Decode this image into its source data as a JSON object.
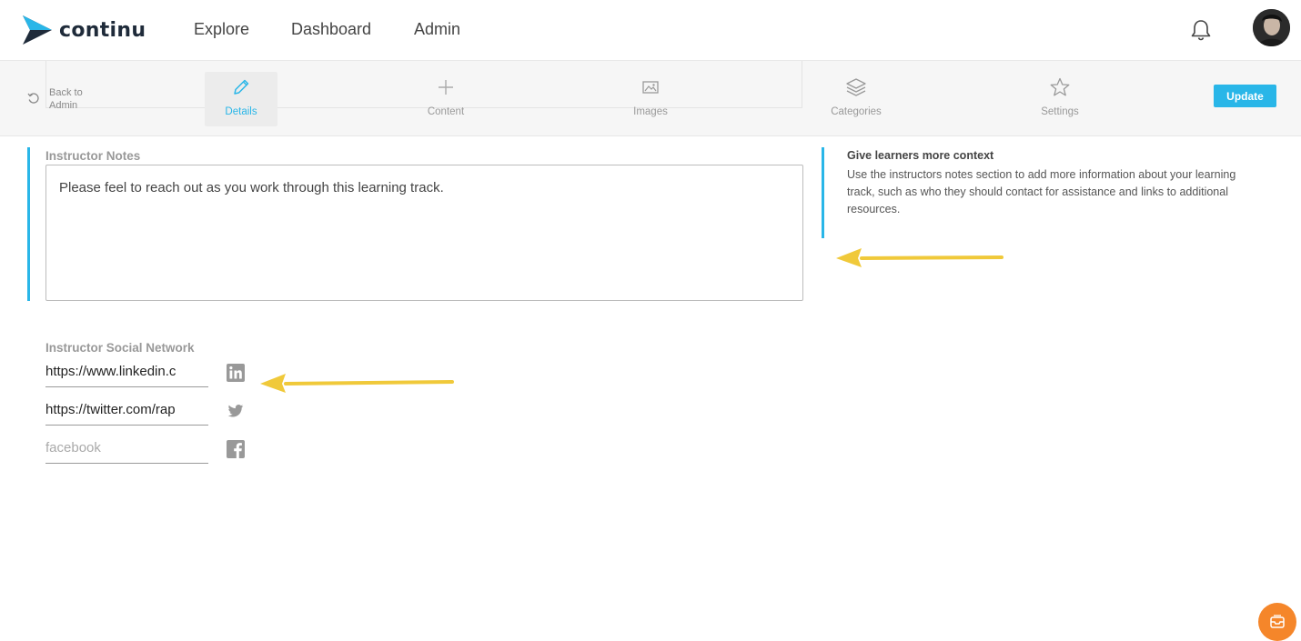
{
  "brand": {
    "name": "continu",
    "accent_color": "#29b6e8",
    "logo_dark": "#1f2b3a"
  },
  "nav": {
    "items": [
      "Explore",
      "Dashboard",
      "Admin"
    ]
  },
  "header_icons": {
    "notifications": "bell-icon",
    "profile": "avatar"
  },
  "subnav": {
    "back_label_line1": "Back to",
    "back_label_line2": "Admin",
    "tabs": [
      {
        "label": "Details",
        "icon": "pencil-icon",
        "active": true
      },
      {
        "label": "Content",
        "icon": "plus-icon",
        "active": false
      },
      {
        "label": "Images",
        "icon": "image-icon",
        "active": false
      },
      {
        "label": "Categories",
        "icon": "layers-icon",
        "active": false
      },
      {
        "label": "Settings",
        "icon": "star-icon",
        "active": false
      }
    ],
    "update_label": "Update"
  },
  "instructor_notes": {
    "label": "Instructor Notes",
    "value": "Please feel to reach out as you work through this learning track."
  },
  "help": {
    "title": "Give learners more context",
    "body": "Use the instructors notes section to add more information about your learning track, such as who they should contact for assistance and links to additional resources."
  },
  "social": {
    "label": "Instructor Social Network",
    "linkedin_value": "https://www.linkedin.c",
    "twitter_value": "https://twitter.com/rap",
    "facebook_placeholder": "facebook"
  },
  "annotation_color": "#f0c93a",
  "help_fab_color": "#f5862a"
}
